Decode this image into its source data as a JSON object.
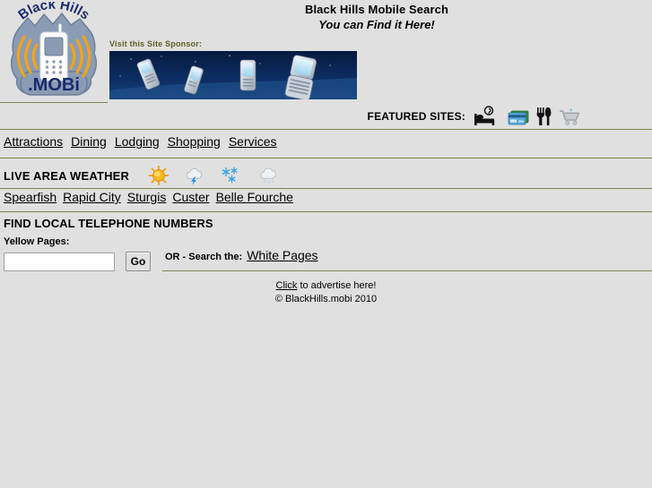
{
  "site": {
    "logo_top_text": "Black Hills",
    "logo_bottom_text": ".MOBi"
  },
  "header": {
    "title": "Black Hills Mobile Search",
    "tagline": "You can Find it Here!",
    "sponsor_label": "Visit this Site Sponsor:",
    "sponsor_banner_alt": "cell-phones-banner"
  },
  "featured": {
    "label": "FEATURED SITES:",
    "icons": [
      {
        "name": "bed-icon",
        "title": "Lodging"
      },
      {
        "name": "credit-cards-icon",
        "title": "Payments"
      },
      {
        "name": "fork-knife-icon",
        "title": "Dining"
      },
      {
        "name": "shopping-cart-icon",
        "title": "Shopping"
      }
    ]
  },
  "nav": {
    "items": [
      {
        "label": "Attractions"
      },
      {
        "label": "Dining"
      },
      {
        "label": "Lodging"
      },
      {
        "label": "Shopping"
      },
      {
        "label": "Services"
      }
    ]
  },
  "weather": {
    "title": "LIVE AREA WEATHER",
    "icons": [
      {
        "name": "sun-icon",
        "title": "Sunny"
      },
      {
        "name": "thunderstorm-icon",
        "title": "Thunderstorms"
      },
      {
        "name": "snow-icon",
        "title": "Snow"
      },
      {
        "name": "rain-cloud-icon",
        "title": "Rain"
      }
    ],
    "cities": [
      {
        "label": "Spearfish"
      },
      {
        "label": "Rapid City"
      },
      {
        "label": "Sturgis"
      },
      {
        "label": "Custer"
      },
      {
        "label": "Belle Fourche"
      }
    ]
  },
  "phone": {
    "title": "FIND LOCAL TELEPHONE NUMBERS",
    "yellow_pages_label": "Yellow Pages:",
    "search_value": "",
    "search_placeholder": "",
    "go_label": "Go",
    "or_text": "OR - Search the:",
    "white_pages_label": "White Pages"
  },
  "footer": {
    "advertise_link": "Click",
    "advertise_text": " to advertise here!",
    "copyright": "© BlackHills.mobi 2010"
  },
  "colors": {
    "page_bg": "#e0e0e0",
    "rule": "#7d8650",
    "sponsor_label": "#5c5f20",
    "logo_body": "#8a9cb4",
    "logo_text": "#1b2a6b",
    "banner_bg": "#0b2a5e"
  }
}
